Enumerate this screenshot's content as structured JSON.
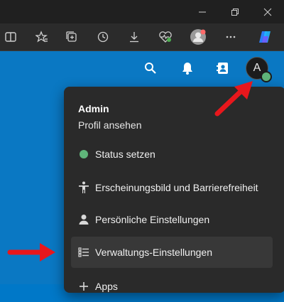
{
  "browser": {
    "window_controls": {
      "minimize_icon": "minimize-icon",
      "restore_icon": "restore-icon",
      "close_icon": "close-icon"
    },
    "toolbar_icons": [
      "split-screen-icon",
      "favorites-icon",
      "collections-icon",
      "history-icon",
      "downloads-icon",
      "browser-essentials-icon",
      "profile-icon",
      "more-icon",
      "copilot-icon"
    ]
  },
  "header": {
    "icons": [
      "search-icon",
      "notifications-icon",
      "contacts-icon"
    ],
    "avatar_letter": "A",
    "status_color": "#5fb57a"
  },
  "menu": {
    "user_name": "Admin",
    "profile_link": "Profil ansehen",
    "items": [
      {
        "label": "Status setzen",
        "icon": "status-dot-icon"
      },
      {
        "label": "Erscheinungsbild und Barrierefreiheit",
        "icon": "accessibility-icon"
      },
      {
        "label": "Persönliche Einstellungen",
        "icon": "person-icon"
      },
      {
        "label": "Verwaltungs-Einstellungen",
        "icon": "admin-list-icon"
      },
      {
        "label": "Apps",
        "icon": "apps-icon"
      }
    ]
  },
  "colors": {
    "header_blue": "#0a78c3",
    "menu_bg": "#2a2a2a",
    "arrow_red": "#e8171c"
  }
}
